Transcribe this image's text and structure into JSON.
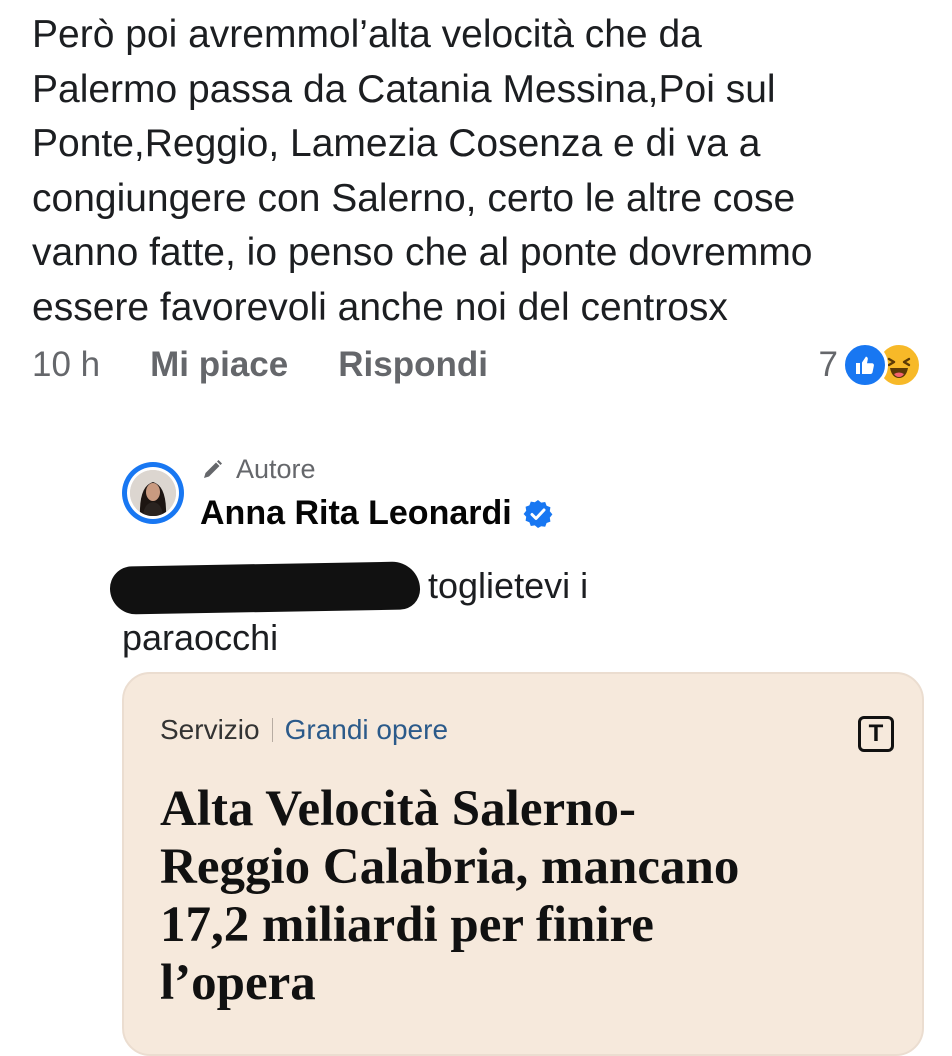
{
  "comment": {
    "text": "Però poi avremmol’alta velocità che da\nPalermo passa da Catania  Messina,Poi sul\nPonte,Reggio, Lamezia Cosenza e di va a\ncongiungere con Salerno, certo le altre cose\nvanno fatte, io penso che al ponte dovremmo\nessere favorevoli anche noi del centrosx",
    "time": "10 h",
    "like_label": "Mi piace",
    "reply_label": "Rispondi",
    "reaction_count": "7",
    "reaction_icons": [
      "like-reaction-icon",
      "haha-reaction-icon"
    ]
  },
  "reply": {
    "badge": "Autore",
    "author": "Anna Rita Leonardi",
    "text_after_redaction": "toglietevi i",
    "text_line2": "paraocchi"
  },
  "link_card": {
    "section": "Servizio",
    "topic": "Grandi opere",
    "logo_letter": "T",
    "headline": "Alta Velocità Salerno-\nReggio Calabria, mancano\n17,2 miliardi per finire\nl’opera"
  },
  "colors": {
    "text": "#1c1e21",
    "muted": "#65676b",
    "facebook_blue": "#1877f2",
    "card_bg": "#f6e9dc",
    "topic_link": "#2b5a8a"
  }
}
